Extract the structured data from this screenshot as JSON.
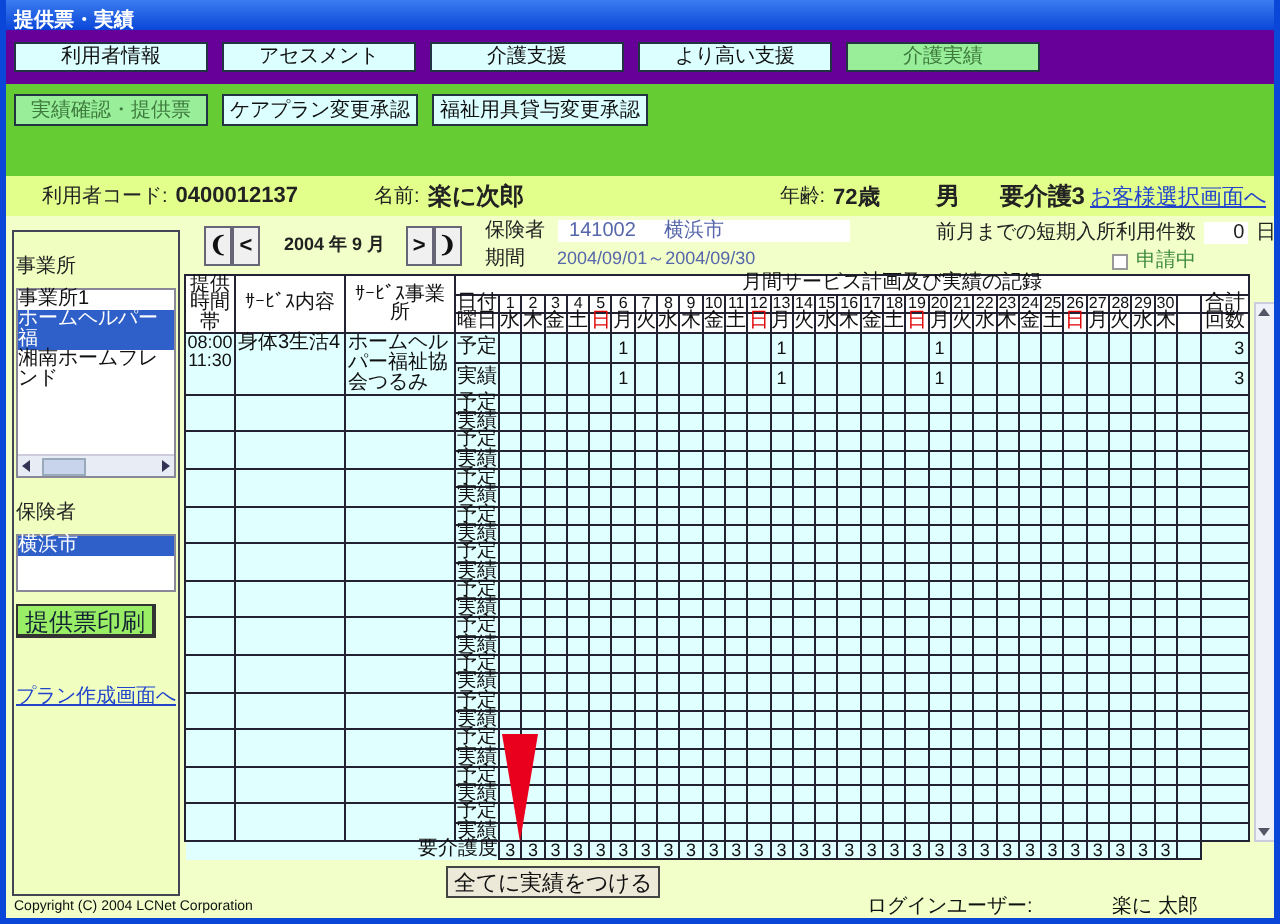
{
  "window": {
    "title": "提供票・実績"
  },
  "tabs": [
    {
      "label": "利用者情報",
      "selected": false
    },
    {
      "label": "アセスメント",
      "selected": false
    },
    {
      "label": "介護支援",
      "selected": false
    },
    {
      "label": "より高い支援",
      "selected": false
    },
    {
      "label": "介護実績",
      "selected": true
    }
  ],
  "subtabs": [
    {
      "label": "実績確認・提供票",
      "selected": true
    },
    {
      "label": "ケアプラン変更承認",
      "selected": false
    },
    {
      "label": "福祉用具貸与変更承認",
      "selected": false
    }
  ],
  "user": {
    "code_label": "利用者コード:",
    "code": "0400012137",
    "name_label": "名前:",
    "name": "楽に次郎",
    "age_label": "年齢:",
    "age": "72歳",
    "gender": "男",
    "care_level": "要介護3",
    "link": "お客様選択画面へ"
  },
  "sidebar": {
    "office_label": "事業所",
    "offices": [
      {
        "label": "事業所1",
        "selected": false
      },
      {
        "label": "ホームヘルパー福",
        "selected": true
      },
      {
        "label": "湘南ホームフレンド",
        "selected": false
      }
    ],
    "insurer_label": "保険者",
    "insurers": [
      {
        "label": "横浜市",
        "selected": true
      }
    ],
    "print_button": "提供票印刷",
    "plan_link": "プラン作成画面へ"
  },
  "month_nav": {
    "first": "❨",
    "prev": "<",
    "month": "2004 年 9 月",
    "next": ">",
    "last": "❩"
  },
  "insurer": {
    "label": "保険者",
    "number": "141002",
    "name": "横浜市"
  },
  "period": {
    "label": "期間",
    "value": "2004/09/01～2004/09/30"
  },
  "short_stay": {
    "label": "前月までの短期入所利用件数",
    "value": "0",
    "unit": "日"
  },
  "application": {
    "label": "申請中",
    "checked": false,
    "disabled": true
  },
  "grid": {
    "title": "月間サービス計画及び実績の記録",
    "time_header": "提供時間帯",
    "service_header": "ｻｰﾋﾞｽ内容",
    "office_header": "ｻｰﾋﾞｽ事業所",
    "date_label": "日付",
    "dow_label": "曜日",
    "total_top": "合計",
    "total_bottom": "回数",
    "days": [
      {
        "day": "1",
        "dow": "水",
        "holiday": false
      },
      {
        "day": "2",
        "dow": "木",
        "holiday": false
      },
      {
        "day": "3",
        "dow": "金",
        "holiday": false
      },
      {
        "day": "4",
        "dow": "土",
        "holiday": false
      },
      {
        "day": "5",
        "dow": "日",
        "holiday": true
      },
      {
        "day": "6",
        "dow": "月",
        "holiday": false
      },
      {
        "day": "7",
        "dow": "火",
        "holiday": false
      },
      {
        "day": "8",
        "dow": "水",
        "holiday": false
      },
      {
        "day": "9",
        "dow": "木",
        "holiday": false
      },
      {
        "day": "10",
        "dow": "金",
        "holiday": false
      },
      {
        "day": "11",
        "dow": "土",
        "holiday": false
      },
      {
        "day": "12",
        "dow": "日",
        "holiday": true
      },
      {
        "day": "13",
        "dow": "月",
        "holiday": false
      },
      {
        "day": "14",
        "dow": "火",
        "holiday": false
      },
      {
        "day": "15",
        "dow": "水",
        "holiday": false
      },
      {
        "day": "16",
        "dow": "木",
        "holiday": false
      },
      {
        "day": "17",
        "dow": "金",
        "holiday": false
      },
      {
        "day": "18",
        "dow": "土",
        "holiday": false
      },
      {
        "day": "19",
        "dow": "日",
        "holiday": true
      },
      {
        "day": "20",
        "dow": "月",
        "holiday": false
      },
      {
        "day": "21",
        "dow": "火",
        "holiday": false
      },
      {
        "day": "22",
        "dow": "水",
        "holiday": false
      },
      {
        "day": "23",
        "dow": "木",
        "holiday": false
      },
      {
        "day": "24",
        "dow": "金",
        "holiday": false
      },
      {
        "day": "25",
        "dow": "土",
        "holiday": false
      },
      {
        "day": "26",
        "dow": "日",
        "holiday": true
      },
      {
        "day": "27",
        "dow": "月",
        "holiday": false
      },
      {
        "day": "28",
        "dow": "火",
        "holiday": false
      },
      {
        "day": "29",
        "dow": "水",
        "holiday": false
      },
      {
        "day": "30",
        "dow": "木",
        "holiday": false
      }
    ],
    "rows": [
      {
        "time": [
          "08:00",
          "11:30"
        ],
        "service": "身体3生活4",
        "office": "ホームヘルパー福祉協会つるみ",
        "plan_label": "予定",
        "actual_label": "実績",
        "plan": [
          {
            "filled": false
          },
          {
            "filled": false
          },
          {
            "filled": false
          },
          {
            "filled": false
          },
          {
            "filled": false
          },
          {
            "filled": true,
            "count": "1"
          },
          {
            "filled": false
          },
          {
            "filled": false
          },
          {
            "filled": false
          },
          {
            "filled": false
          },
          {
            "filled": false
          },
          {
            "filled": false
          },
          {
            "filled": true,
            "count": "1"
          },
          {
            "filled": false
          },
          {
            "filled": false
          },
          {
            "filled": false
          },
          {
            "filled": false
          },
          {
            "filled": false
          },
          {
            "filled": false
          },
          {
            "filled": true,
            "count": "1"
          },
          {
            "filled": false
          },
          {
            "filled": false
          },
          {
            "filled": false
          },
          {
            "filled": false
          },
          {
            "filled": false
          },
          {
            "filled": false
          },
          {
            "filled": false
          },
          {
            "filled": false
          },
          {
            "filled": false
          },
          {
            "filled": false
          }
        ],
        "actual": [
          {
            "filled": false
          },
          {
            "filled": false
          },
          {
            "filled": false
          },
          {
            "filled": false
          },
          {
            "filled": false
          },
          {
            "filled": true,
            "count": "1"
          },
          {
            "filled": false
          },
          {
            "filled": false
          },
          {
            "filled": false
          },
          {
            "filled": false
          },
          {
            "filled": false
          },
          {
            "filled": false
          },
          {
            "filled": true,
            "count": "1"
          },
          {
            "filled": false
          },
          {
            "filled": false
          },
          {
            "filled": false
          },
          {
            "filled": false
          },
          {
            "filled": false
          },
          {
            "filled": false
          },
          {
            "filled": true,
            "count": "1"
          },
          {
            "filled": false
          },
          {
            "filled": false
          },
          {
            "filled": false
          },
          {
            "filled": false
          },
          {
            "filled": false
          },
          {
            "filled": false
          },
          {
            "filled": false
          },
          {
            "filled": false
          },
          {
            "filled": false
          },
          {
            "filled": false
          }
        ],
        "plan_total": "3",
        "actual_total": "3"
      },
      {
        "plan_label": "予定",
        "actual_label": "実績"
      },
      {
        "plan_label": "予定",
        "actual_label": "実績"
      },
      {
        "plan_label": "予定",
        "actual_label": "実績"
      },
      {
        "plan_label": "予定",
        "actual_label": "実績"
      },
      {
        "plan_label": "予定",
        "actual_label": "実績"
      },
      {
        "plan_label": "予定",
        "actual_label": "実績"
      },
      {
        "plan_label": "予定",
        "actual_label": "実績"
      },
      {
        "plan_label": "予定",
        "actual_label": "実績"
      },
      {
        "plan_label": "予定",
        "actual_label": "実績"
      },
      {
        "plan_label": "予定",
        "actual_label": "実績"
      },
      {
        "plan_label": "予定",
        "actual_label": "実績"
      },
      {
        "plan_label": "予定",
        "actual_label": "実績"
      }
    ],
    "care_label": "要介護度",
    "care_values": [
      "3",
      "3",
      "3",
      "3",
      "3",
      "3",
      "3",
      "3",
      "3",
      "3",
      "3",
      "3",
      "3",
      "3",
      "3",
      "3",
      "3",
      "3",
      "3",
      "3",
      "3",
      "3",
      "3",
      "3",
      "3",
      "3",
      "3",
      "3",
      "3",
      "3"
    ]
  },
  "apply_button": "全てに実績をつける",
  "footer": {
    "copyright": "Copyright (C) 2004 LCNet Corporation",
    "login_label": "ログインユーザー:",
    "login_user": "楽に 太郎"
  }
}
